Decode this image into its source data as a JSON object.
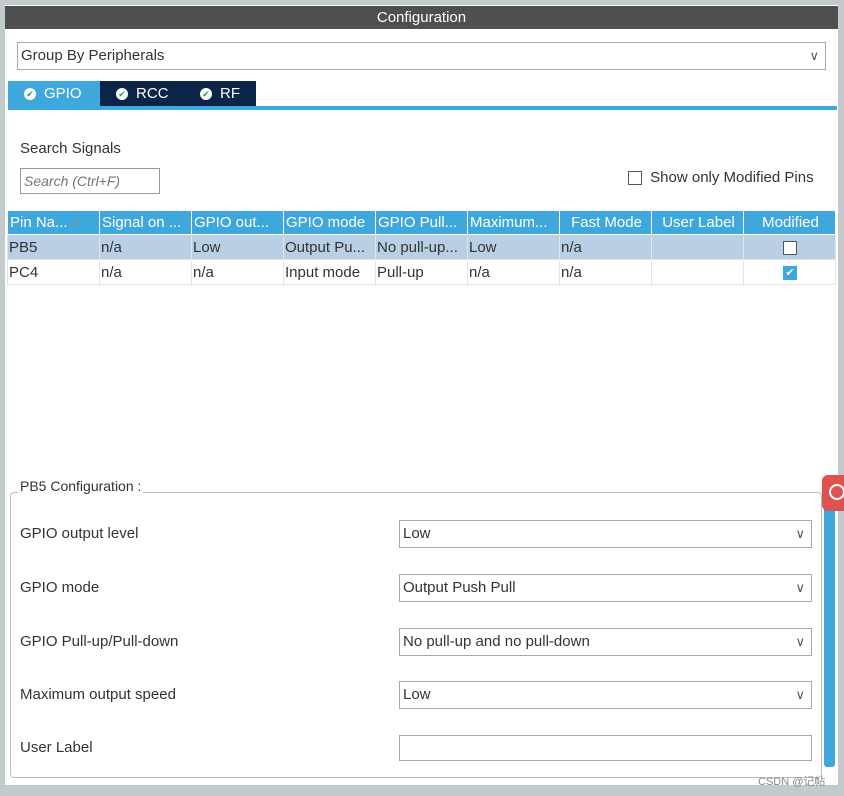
{
  "title": "Configuration",
  "group_by": "Group By Peripherals",
  "tabs": [
    {
      "label": "GPIO",
      "active": true
    },
    {
      "label": "RCC",
      "active": false
    },
    {
      "label": "RF",
      "active": false
    }
  ],
  "search": {
    "label": "Search Signals",
    "placeholder": "Search (Ctrl+F)"
  },
  "show_modified": {
    "label": "Show only Modified Pins",
    "checked": false
  },
  "table": {
    "headers": [
      "Pin Na...",
      "Signal on ...",
      "GPIO out...",
      "GPIO mode",
      "GPIO Pull...",
      "Maximum...",
      "Fast Mode",
      "User Label",
      "Modified"
    ],
    "rows": [
      [
        "PB5",
        "n/a",
        "Low",
        "Output Pu...",
        "No pull-up...",
        "Low",
        "n/a",
        "",
        false
      ],
      [
        "PC4",
        "n/a",
        "n/a",
        "Input mode",
        "Pull-up",
        "n/a",
        "n/a",
        "",
        true
      ]
    ]
  },
  "config": {
    "group_title": "PB5 Configuration :",
    "fields": [
      {
        "label": "GPIO output level",
        "value": "Low"
      },
      {
        "label": "GPIO mode",
        "value": "Output Push Pull"
      },
      {
        "label": "GPIO Pull-up/Pull-down",
        "value": "No pull-up and no pull-down"
      },
      {
        "label": "Maximum output speed",
        "value": "Low"
      }
    ],
    "user_label": {
      "label": "User Label",
      "value": ""
    }
  },
  "watermark": "CSDN @记帖",
  "colors": {
    "accent": "#3ea8dd",
    "tab_dark": "#0b2447",
    "title_bar": "#4f4f4f",
    "selected_row": "#b8cfe6"
  }
}
